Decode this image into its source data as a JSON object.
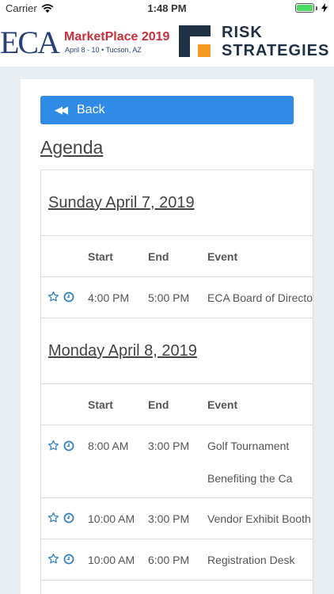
{
  "status_bar": {
    "carrier": "Carrier",
    "time": "1:48 PM"
  },
  "header": {
    "eca_logo": {
      "letters": "ECA",
      "title": "MarketPlace 2019",
      "subtitle": "April 8 - 10 • Tucson, AZ"
    },
    "risk_logo": {
      "line1": "RISK",
      "line2": "STRATEGIES"
    }
  },
  "back_button": {
    "label": "Back"
  },
  "page_title": "Agenda",
  "columns": {
    "start": "Start",
    "end": "End",
    "event": "Event"
  },
  "days": [
    {
      "title": "Sunday April 7, 2019",
      "events": [
        {
          "start": "4:00 PM",
          "end": "5:00 PM",
          "event": "ECA Board of Directors"
        }
      ]
    },
    {
      "title": "Monday April 8, 2019",
      "events": [
        {
          "start": "8:00 AM",
          "end": "3:00 PM",
          "event": "Golf Tournament",
          "event_line2": "Benefiting the Ca"
        },
        {
          "start": "10:00 AM",
          "end": "3:00 PM",
          "event": "Vendor Exhibit Booth"
        },
        {
          "start": "10:00 AM",
          "end": "6:00 PM",
          "event": "Registration Desk"
        }
      ]
    }
  ],
  "colors": {
    "accent": "#2f8be6",
    "eca_blue": "#27407a",
    "eca_red": "#c5303a",
    "risk_navy": "#1f3044",
    "risk_orange": "#f59a23"
  }
}
